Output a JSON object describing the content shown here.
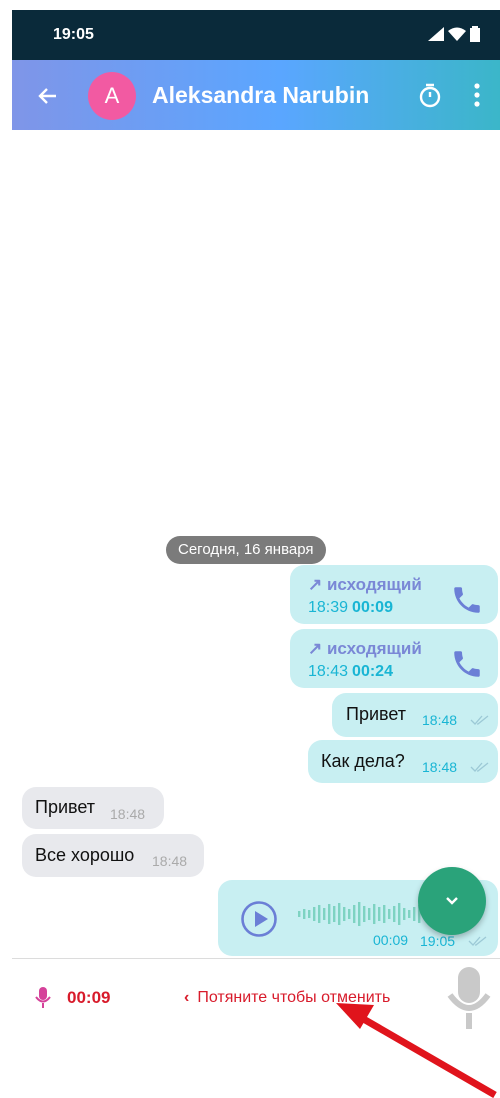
{
  "status_bar": {
    "time": "19:05"
  },
  "header": {
    "avatar_letter": "A",
    "title": "Aleksandra Narubin"
  },
  "chat": {
    "date_separator": "Сегодня, 16 января",
    "calls": [
      {
        "direction": "↗ исходящий",
        "time": "18:39",
        "duration": "00:09"
      },
      {
        "direction": "↗ исходящий",
        "time": "18:43",
        "duration": "00:24"
      }
    ],
    "outgoing_messages": [
      {
        "text": "Привет",
        "time": "18:48"
      },
      {
        "text": "Как дела?",
        "time": "18:48"
      }
    ],
    "incoming_messages": [
      {
        "text": "Привет",
        "time": "18:48"
      },
      {
        "text": "Все хорошо",
        "time": "18:48"
      }
    ],
    "voice_message": {
      "duration": "00:09",
      "time": "19:05"
    }
  },
  "recorder": {
    "elapsed": "00:09",
    "slide_to_cancel": "Потяните чтобы отменить",
    "slide_arrow": "‹"
  },
  "colors": {
    "accent": "#19b5d4",
    "record_red": "#d81b2b",
    "fab_green": "#2aa37a",
    "outgoing_bubble": "#c8eff2"
  }
}
